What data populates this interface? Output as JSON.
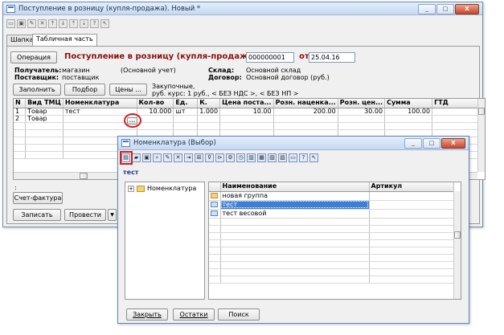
{
  "main_window": {
    "title": "Поступление в розницу (купля-продажа). Новый *",
    "tabs": [
      "Шапка",
      "Табличная часть"
    ],
    "operation_button": "Операция",
    "doc_heading": "Поступление в розницу (купля-продажа) №",
    "doc_number": "000000001",
    "from_label": "от",
    "doc_date": "25.04.16",
    "recipient_label": "Получатель:",
    "recipient_value": "магазин",
    "recipient_note": "(Основной учет)",
    "supplier_label": "Поставщик:",
    "supplier_value": "поставщик",
    "warehouse_label": "Склад:",
    "warehouse_value": "Основной склад",
    "contract_label": "Договор:",
    "contract_value": "Основной договор (руб.)",
    "fill_button": "Заполнить",
    "select_button": "Подбор",
    "prices_button": "Цены ...",
    "price_info_1": "Закупочные,",
    "price_info_2": "руб. курс: 1 руб., < БЕЗ НДС >, < БЕЗ НП >",
    "columns": [
      "N",
      "Вид ТМЦ",
      "Номенклатура",
      "Кол-во",
      "Ед.",
      "К.",
      "Цена поста...",
      "Розн. наценка...",
      "Розн. цен...",
      "Сумма",
      "ГТД"
    ],
    "rows": [
      [
        "1",
        "Товар",
        "тест",
        "10.000",
        "шт",
        "1.000",
        "10.00",
        "200.00",
        "30.00",
        "100.00",
        ""
      ],
      [
        "2",
        "Товар",
        "",
        "",
        "",
        "",
        "",
        "",
        "",
        "",
        ""
      ]
    ],
    "ellipsis_button": "...",
    "comment_mark": ":",
    "invoice_button": "Счет-фактура",
    "record_button": "Записать",
    "post_button": "Провести",
    "dropdown_arrow": "▼"
  },
  "dialog": {
    "title": "Номенклатура (Выбор)",
    "path_label": "тест",
    "tree_root": "Номенклатура",
    "tree_expander": "+",
    "list_columns": [
      "Наименование",
      "Артикул"
    ],
    "list_items": [
      {
        "name": "новая группа",
        "article": "",
        "kind": "group"
      },
      {
        "name": "тест",
        "article": "",
        "kind": "item",
        "selected": true
      },
      {
        "name": "тест весовой",
        "article": "",
        "kind": "item"
      }
    ],
    "close_button": "Закрыть",
    "stock_button": "Остатки",
    "search_button": "Поиск"
  },
  "title_buttons": {
    "min": "_",
    "max": "□",
    "close": "X"
  },
  "colors": {
    "heading": "#8b0d0d",
    "selected_row": "#3d7fd6",
    "highlight": "#d81c1c"
  }
}
